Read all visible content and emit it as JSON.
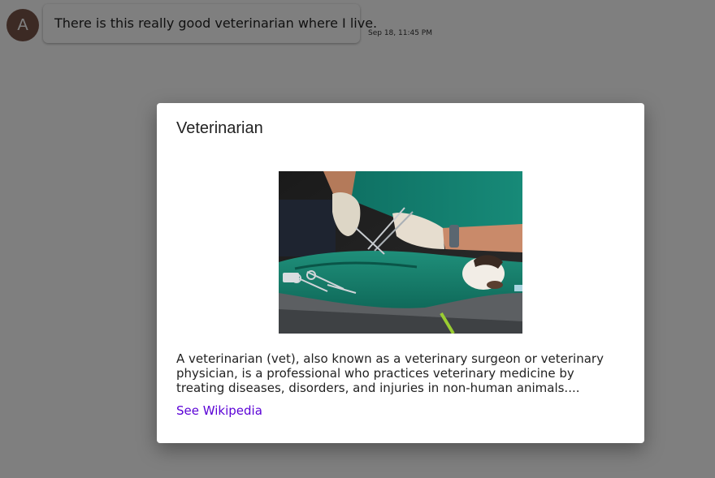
{
  "chat": {
    "avatar_initial": "A",
    "avatar_color": "#795548",
    "message_text": "There is this really good veterinarian where I live.",
    "timestamp": "Sep 18, 11:45 PM"
  },
  "modal": {
    "title": "Veterinarian",
    "image_alt": "veterinarian performing surgery on a cat",
    "description": "A veterinarian (vet), also known as a veterinary surgeon or veterinary physician, is a professional who practices veterinary medicine by treating diseases, disorders, and injuries in non-human animals....",
    "link_label": "See Wikipedia",
    "link_color": "#5a00d6"
  }
}
